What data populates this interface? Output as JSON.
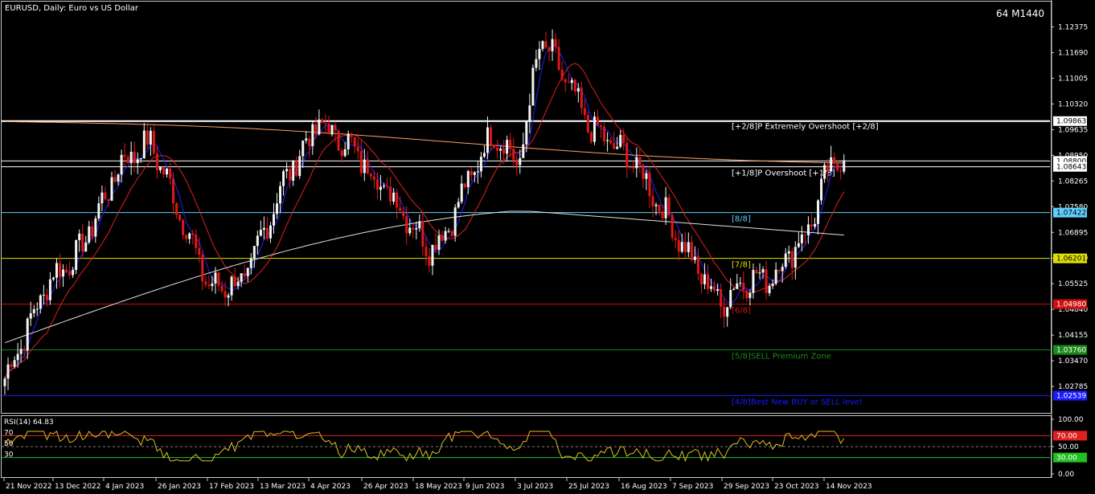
{
  "window": {
    "title": "EURUSD, Daily:  Euro vs US Dollar",
    "badge": "64 M1440"
  },
  "chart_data": {
    "type": "candlestick",
    "symbol": "EURUSD",
    "timeframe": "Daily",
    "description": "Euro vs US Dollar",
    "ylim": [
      1.0208,
      1.1305
    ],
    "y_ticks": [
      "1.12375",
      "1.11690",
      "1.11005",
      "1.10320",
      "1.09635",
      "1.08950",
      "1.08265",
      "1.07580",
      "1.06895",
      "1.06210",
      "1.05525",
      "1.04840",
      "1.04155",
      "1.03470",
      "1.02785"
    ],
    "x_ticks": [
      "21 Nov 2022",
      "13 Dec 2022",
      "4 Jan 2023",
      "26 Jan 2023",
      "17 Feb 2023",
      "13 Mar 2023",
      "4 Apr 2023",
      "26 Apr 2023",
      "18 May 2023",
      "9 Jun 2023",
      "3 Jul 2023",
      "25 Jul 2023",
      "16 Aug 2023",
      "7 Sep 2023",
      "29 Sep 2023",
      "23 Oct 2023",
      "14 Nov 2023"
    ],
    "price_path": [
      [
        0,
        1.03
      ],
      [
        15,
        1.056
      ],
      [
        25,
        1.063
      ],
      [
        40,
        1.088
      ],
      [
        50,
        1.093
      ],
      [
        60,
        1.074
      ],
      [
        70,
        1.054
      ],
      [
        82,
        1.056
      ],
      [
        95,
        1.082
      ],
      [
        107,
        1.098
      ],
      [
        118,
        1.092
      ],
      [
        135,
        1.076
      ],
      [
        145,
        1.065
      ],
      [
        150,
        1.068
      ],
      [
        157,
        1.08
      ],
      [
        167,
        1.096
      ],
      [
        176,
        1.087
      ],
      [
        183,
        1.12
      ],
      [
        188,
        1.115
      ],
      [
        200,
        1.097
      ],
      [
        215,
        1.088
      ],
      [
        228,
        1.071
      ],
      [
        236,
        1.06
      ],
      [
        245,
        1.05
      ],
      [
        252,
        1.056
      ],
      [
        262,
        1.057
      ],
      [
        268,
        1.063
      ],
      [
        275,
        1.07
      ],
      [
        282,
        1.086
      ],
      [
        287,
        1.089
      ]
    ],
    "levels": [
      {
        "price": 1.09863,
        "label_text": "[+2/8]P Extremely Overshoot [+2/8]",
        "tag": "1.09863",
        "color": "#ffffff",
        "width": 2
      },
      {
        "price": 1.088,
        "label_text": "",
        "tag": "1.08800",
        "color": "#ffffff",
        "width": 1
      },
      {
        "price": 1.08643,
        "label_text": "[+1/8]P Overshoot [+1/8]",
        "tag": "1.08643",
        "color": "#ffffff",
        "width": 1
      },
      {
        "price": 1.07422,
        "label_text": "[8/8]",
        "tag": "1.07422",
        "color": "#5fd0ff",
        "width": 1
      },
      {
        "price": 1.06201,
        "label_text": "[7/8]",
        "tag": "1.06201",
        "color": "#e0e000",
        "width": 1
      },
      {
        "price": 1.0498,
        "label_text": "[6/8]",
        "tag": "1.04980",
        "color": "#d01010",
        "width": 1
      },
      {
        "price": 1.0376,
        "label_text": "[5/8]SELL Premium Zone",
        "tag": "1.03760",
        "color": "#1a8a1a",
        "width": 1
      },
      {
        "price": 1.02539,
        "label_text": "[4/8]Best New BUY or SELL level",
        "tag": "1.02539",
        "color": "#1a1aff",
        "width": 1
      }
    ],
    "moving_averages": [
      {
        "color": "#2020ff",
        "period": 10
      },
      {
        "color": "#e02020",
        "period": 30
      },
      {
        "color": "#e0e0e0",
        "period": 100
      },
      {
        "color": "#ffa060",
        "period": 200
      }
    ],
    "rsi": {
      "label": "RSI(14) 64.83",
      "period": 14,
      "value": 64.83,
      "ylim": [
        0,
        100
      ],
      "y_ticks": [
        "100.00",
        "50.00",
        "0.00"
      ],
      "levels": [
        {
          "value": 70,
          "left_label": "70",
          "tag": "70.00",
          "color": "#e02020"
        },
        {
          "value": 50,
          "left_label": "50",
          "tag": "",
          "color": "#808080"
        },
        {
          "value": 30,
          "left_label": "30",
          "tag": "30.00",
          "color": "#20c020"
        }
      ]
    }
  }
}
